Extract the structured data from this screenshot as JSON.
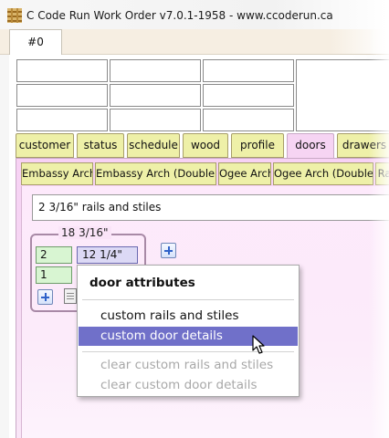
{
  "window": {
    "title": "C Code Run Work Order v7.0.1-1958 - www.ccoderun.ca",
    "icon": "app-icon"
  },
  "document_tabs": [
    {
      "label": "#0",
      "active": true
    }
  ],
  "category_tabs": [
    {
      "label": "customer",
      "active": false
    },
    {
      "label": "status",
      "active": false
    },
    {
      "label": "schedule",
      "active": false
    },
    {
      "label": "wood",
      "active": false
    },
    {
      "label": "profile",
      "active": false
    },
    {
      "label": "doors",
      "active": true
    },
    {
      "label": "drawers",
      "active": false
    }
  ],
  "style_tabs": [
    {
      "label": "Embassy Arch"
    },
    {
      "label": "Embassy Arch (Double)"
    },
    {
      "label": "Ogee Arch"
    },
    {
      "label": "Ogee Arch (Double)"
    },
    {
      "label": "Ra"
    }
  ],
  "rails_field": {
    "value": "2 3/16\" rails and stiles"
  },
  "door_group": {
    "width_label": "18 3/16\"",
    "quantity": "2",
    "height": "12 1/4\"",
    "second_quantity": "1"
  },
  "context_menu": {
    "title": "door attributes",
    "items": [
      {
        "label": "custom rails and stiles",
        "state": "normal"
      },
      {
        "label": "custom door details",
        "state": "selected"
      },
      {
        "label": "clear custom rails and stiles",
        "state": "disabled"
      },
      {
        "label": "clear custom door details",
        "state": "disabled"
      }
    ]
  },
  "colors": {
    "selected_highlight": "#7070c9",
    "active_tab": "#f6d4f3",
    "inactive_tab": "#eef0a8",
    "quantity_field": "#d8f5d2",
    "height_field": "#dcd9f5"
  }
}
